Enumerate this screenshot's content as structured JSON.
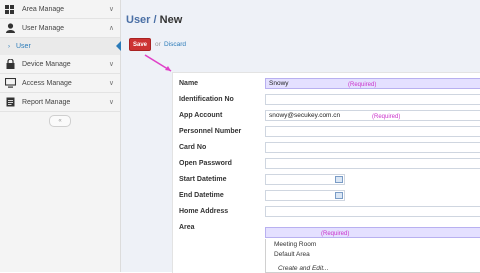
{
  "sidebar": {
    "items": [
      {
        "label": "Area Manage",
        "icon": "grid-icon",
        "chevron": "∨"
      },
      {
        "label": "User Manage",
        "icon": "user-icon",
        "chevron": "∧"
      },
      {
        "label": "Device Manage",
        "icon": "lock-icon",
        "chevron": "∨"
      },
      {
        "label": "Access Manage",
        "icon": "monitor-icon",
        "chevron": "∨"
      },
      {
        "label": "Report Manage",
        "icon": "document-icon",
        "chevron": "∨"
      }
    ],
    "sub_items": [
      {
        "label": "User"
      }
    ],
    "collapse_glyph": "«"
  },
  "header": {
    "breadcrumb_root": "User",
    "separator": "/",
    "page": "New"
  },
  "actions": {
    "save": "Save",
    "or": "or",
    "discard": "Discard"
  },
  "form": {
    "fields": [
      {
        "label": "Name",
        "value": "Snowy",
        "hint": "(Required)"
      },
      {
        "label": "Identification No",
        "value": ""
      },
      {
        "label": "App Account",
        "value": "snowy@secukey.com.cn",
        "hint": "(Required)"
      },
      {
        "label": "Personnel Number",
        "value": ""
      },
      {
        "label": "Card No",
        "value": ""
      },
      {
        "label": "Open Password",
        "value": ""
      },
      {
        "label": "Start Datetime",
        "value": ""
      },
      {
        "label": "End Datetime",
        "value": ""
      },
      {
        "label": "Home Address",
        "value": ""
      },
      {
        "label": "Area",
        "value": "",
        "hint": "(Required)"
      }
    ],
    "area_options": [
      "Meeting Room",
      "Default Area"
    ],
    "area_create": "Create and Edit..."
  },
  "colors": {
    "accent": "#2b7bb9",
    "save": "#cc3333",
    "required": "#cc33cc",
    "highlight": "#e4e0ff"
  }
}
